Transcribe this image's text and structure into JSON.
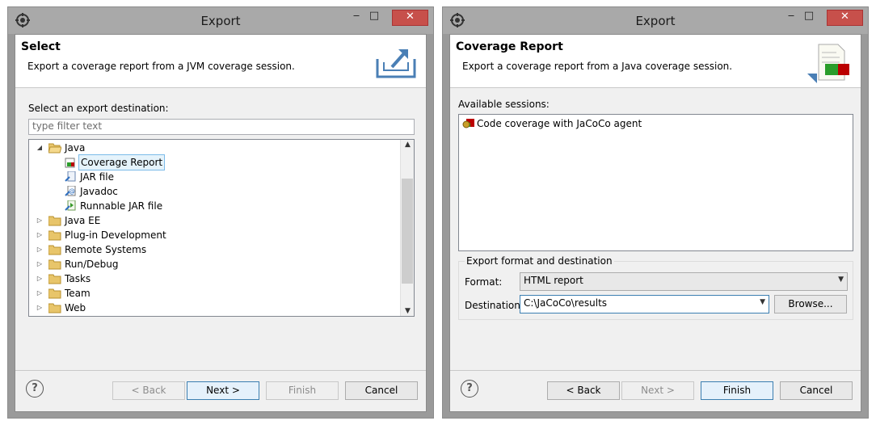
{
  "left_dialog": {
    "title": "Export",
    "banner_title": "Select",
    "banner_desc": "Export a coverage report from a JVM coverage session.",
    "destination_label": "Select an export destination:",
    "filter_placeholder": "type filter text",
    "tree": [
      {
        "label": "Java",
        "expanded": true,
        "icon": "folder-icon"
      },
      {
        "label": "Coverage Report",
        "icon": "coverage-report-icon",
        "selected": true
      },
      {
        "label": "JAR file",
        "icon": "jar-file-icon"
      },
      {
        "label": "Javadoc",
        "icon": "javadoc-icon"
      },
      {
        "label": "Runnable JAR file",
        "icon": "runnable-jar-icon"
      },
      {
        "label": "Java EE",
        "icon": "folder-icon"
      },
      {
        "label": "Plug-in Development",
        "icon": "folder-icon"
      },
      {
        "label": "Remote Systems",
        "icon": "folder-icon"
      },
      {
        "label": "Run/Debug",
        "icon": "folder-icon"
      },
      {
        "label": "Tasks",
        "icon": "folder-icon"
      },
      {
        "label": "Team",
        "icon": "folder-icon"
      },
      {
        "label": "Web",
        "icon": "folder-icon"
      }
    ],
    "buttons": {
      "back": "< Back",
      "next": "Next >",
      "finish": "Finish",
      "cancel": "Cancel"
    }
  },
  "right_dialog": {
    "title": "Export",
    "banner_title": "Coverage Report",
    "banner_desc": "Export a coverage report from a Java coverage session.",
    "sessions_label": "Available sessions:",
    "sessions": [
      {
        "label": "Code coverage with JaCoCo agent",
        "icon": "session-icon"
      }
    ],
    "group_label": "Export format and destination",
    "format_label": "Format:",
    "format_value": "HTML report",
    "destination_label": "Destination:",
    "destination_value": "C:\\JaCoCo\\results",
    "browse_label": "Browse...",
    "buttons": {
      "back": "< Back",
      "next": "Next >",
      "finish": "Finish",
      "cancel": "Cancel"
    }
  },
  "titlebar_buttons": {
    "minimize": "‒",
    "maximize": "□",
    "close": "✕"
  },
  "help_glyph": "?",
  "colors": {
    "close_button": "#c7504b",
    "selection": "#e5f3fb",
    "default_button_border": "#3c7fb1"
  }
}
